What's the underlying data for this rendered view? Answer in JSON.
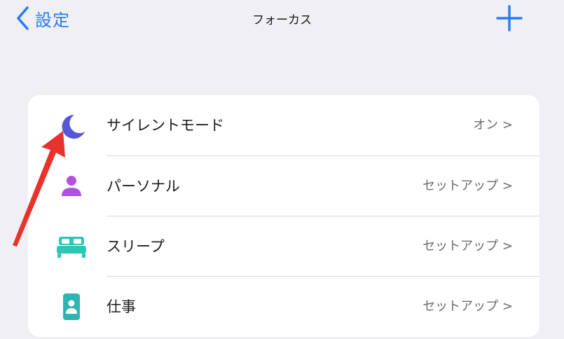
{
  "navbar": {
    "back_label": "設定",
    "title": "フォーカス"
  },
  "focus_modes": [
    {
      "label": "サイレントモード",
      "value": "オン >",
      "icon": "moon-icon"
    },
    {
      "label": "パーソナル",
      "value": "セットアップ >",
      "icon": "person-icon"
    },
    {
      "label": "スリープ",
      "value": "セットアップ >",
      "icon": "bed-icon"
    },
    {
      "label": "仕事",
      "value": "セットアップ >",
      "icon": "id-badge-icon"
    }
  ],
  "colors": {
    "accent": "#2a7cf6",
    "moon": "#5856d6",
    "person": "#af52de",
    "bed": "#30c6b5",
    "work": "#2fb5b0",
    "annotation_arrow": "#e8322c"
  }
}
